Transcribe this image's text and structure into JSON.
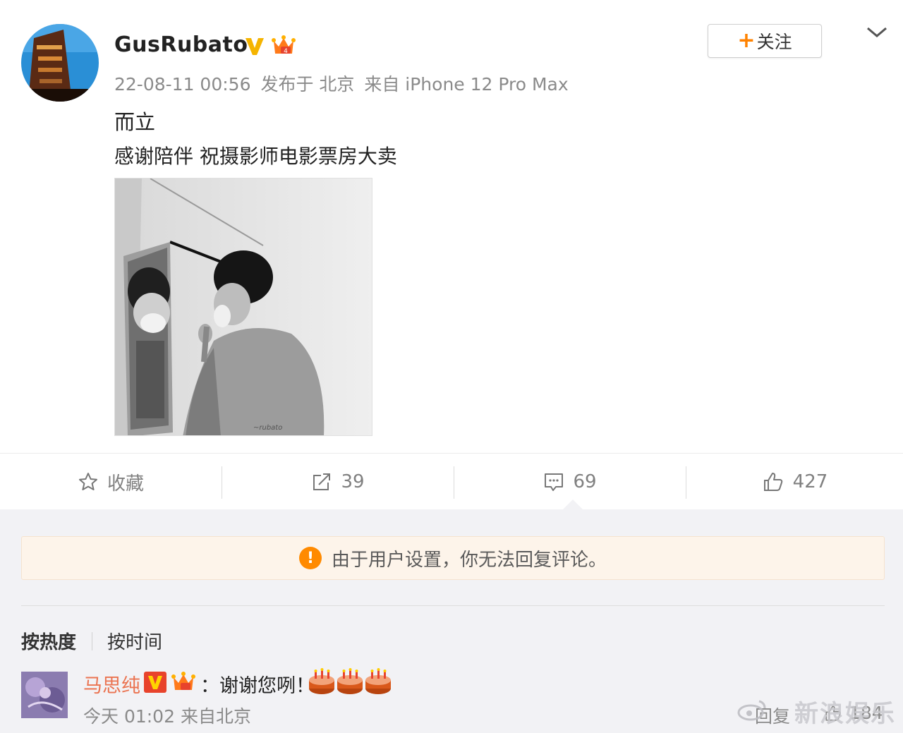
{
  "post": {
    "username": "GusRubato",
    "timestamp": "22-08-11 00:56",
    "location": "发布于 北京",
    "device": "来自 iPhone 12 Pro Max",
    "line1": "而立",
    "line2": "感谢陪伴 祝摄影师电影票房大卖",
    "follow_label": "关注",
    "follow_plus": "+"
  },
  "actions": {
    "favorite_label": "收藏",
    "repost_count": "39",
    "comment_count": "69",
    "like_count": "427"
  },
  "notice": {
    "text": "由于用户设置，你无法回复评论。",
    "icon": "!"
  },
  "sort": {
    "hot_label": "按热度",
    "time_label": "按时间"
  },
  "comment": {
    "name": "马思纯",
    "text": "：谢谢您咧！",
    "meta": "今天 01:02 来自北京",
    "reply_label": "回复",
    "like_count": "184"
  },
  "watermark": "新浪娱乐",
  "colors": {
    "accent": "#ff8200",
    "comment_name": "#eb7350",
    "notice_bg": "#fdf4ea"
  },
  "icons": [
    "avatar",
    "verified-v-icon",
    "crown-icon",
    "chevron-down-icon",
    "star-icon",
    "repost-icon",
    "comment-icon",
    "thumbs-up-icon",
    "warning-icon",
    "cake-icon"
  ]
}
